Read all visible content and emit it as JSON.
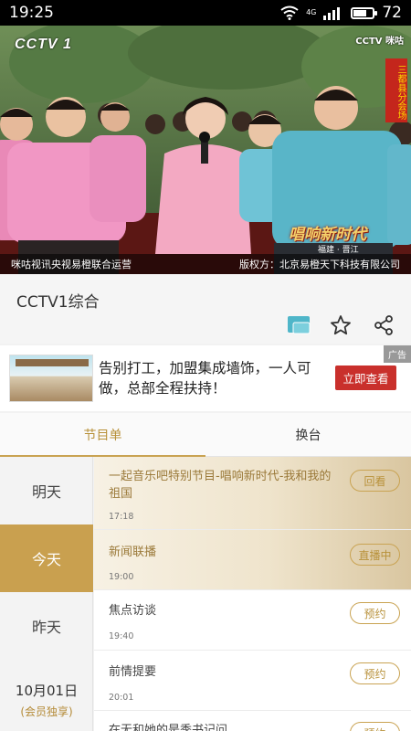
{
  "status": {
    "time": "19:25",
    "network": "4G",
    "battery": "72",
    "battery_level": 0.72
  },
  "video": {
    "channel_logo": "CCTV 1",
    "right_logo": "CCTV 咪咕",
    "side_banner": "三都县分会场",
    "show_logo": "唱响新时代",
    "show_sub": "福建 · 晋江",
    "operator": "咪咕视讯央视易橙联合运营",
    "copyright": "版权方：北京易橙天下科技有限公司"
  },
  "channel": {
    "title": "CCTV1综合"
  },
  "icons": {
    "projection": "cast-icon",
    "favorite": "star-icon",
    "share": "share-icon"
  },
  "ad": {
    "text": "告别打工，加盟集成墙饰，一人可做，总部全程扶持！",
    "cta": "立即查看",
    "tag": "广告"
  },
  "tabs": [
    "节目单",
    "换台"
  ],
  "days": [
    "明天",
    "今天",
    "昨天"
  ],
  "day_date": "10月01日",
  "day_note": "(会员独享)",
  "programs": [
    {
      "title": "一起音乐吧特别节目-唱响新时代-我和我的祖国",
      "time": "17:18",
      "button": "回看"
    },
    {
      "title": "新闻联播",
      "time": "19:00",
      "button": "直播中"
    },
    {
      "title": "焦点访谈",
      "time": "19:40",
      "button": "预约"
    },
    {
      "title": "前情提要",
      "time": "20:01",
      "button": "预约"
    },
    {
      "title": "在无和她的是季书记问",
      "time": "",
      "button": "预约"
    }
  ],
  "colors": {
    "gold": "#c9a352",
    "ad_button": "#c9302c"
  }
}
